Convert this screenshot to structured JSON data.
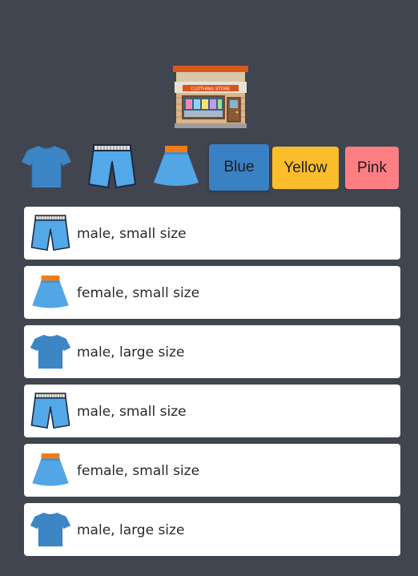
{
  "store": {
    "logo_icon": "clothing-store-icon",
    "sign_text": "CLOTHING STORE"
  },
  "toolbar": {
    "item_buttons": [
      {
        "icon": "tshirt-icon"
      },
      {
        "icon": "shorts-icon"
      },
      {
        "icon": "skirt-icon"
      }
    ],
    "colors": [
      {
        "label": "Blue",
        "color": "#3a80c4"
      },
      {
        "label": "Yellow",
        "color": "#fbbd2b"
      },
      {
        "label": "Pink",
        "color": "#fd7e83"
      }
    ]
  },
  "list": {
    "items": [
      {
        "icon": "shorts-icon",
        "label": "male, small size"
      },
      {
        "icon": "skirt-icon",
        "label": "female, small size"
      },
      {
        "icon": "tshirt-icon",
        "label": "male, large size"
      },
      {
        "icon": "shorts-icon",
        "label": "male, small size"
      },
      {
        "icon": "skirt-icon",
        "label": "female, small size"
      },
      {
        "icon": "tshirt-icon",
        "label": "male, large size"
      }
    ]
  },
  "colors": {
    "background": "#40454f",
    "card": "#ffffff",
    "tshirt": "#3d86c6",
    "shorts": "#53a9e8",
    "skirt": "#52a6e6",
    "skirt_band": "#f47b13"
  }
}
